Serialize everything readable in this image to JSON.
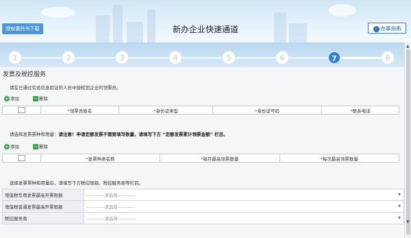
{
  "header": {
    "auth_button": "授权委托书下载",
    "title": "新办企业快速通道",
    "guide_button": "办事指南"
  },
  "steps": {
    "items": [
      "1",
      "2",
      "3",
      "4",
      "5",
      "6",
      "7",
      "8"
    ],
    "active_index": 6
  },
  "section": {
    "title": "发票及税控服务",
    "ticket_note": "请在已通过实名信息验证的人员中授权您企业的领票员。",
    "add_label": "添加",
    "delete_label": "删除",
    "ticket_table_headers": [
      "领票员姓名",
      "身份证类型",
      "身份证号码",
      "联系电话"
    ],
    "invoice_note_prefix": "请选择发票票种和用量：",
    "invoice_note_bold": "请注意！申请定额发票不需要填写数量，请填写下方 “定额发票累计领票金额” 栏目。",
    "invoice_table_headers": [
      "发票种类名称",
      "每月最高领票数量",
      "每次最高领票数量"
    ],
    "service_note": "选择发票票种和用量后，请填写下方税控限额、税控服务商等栏目。",
    "form_rows": [
      {
        "label": "增值税专用发票最高开票限额",
        "placeholder": "-----------请选择-----------"
      },
      {
        "label": "增值税普通发票最高开票限额",
        "placeholder": "-----------请选择-----------"
      },
      {
        "label": "税控服务商",
        "placeholder": "-----------请选择-----------"
      }
    ]
  },
  "colors": {
    "accent": "#2d7fd3",
    "required": "#e02020",
    "add_icon": "#3aa54a"
  }
}
